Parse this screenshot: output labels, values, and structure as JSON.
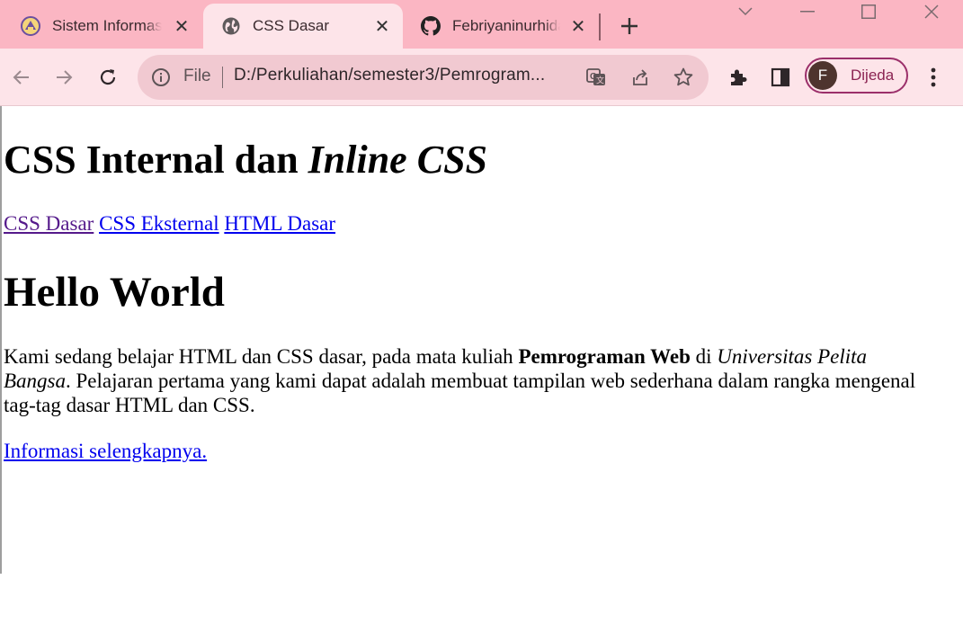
{
  "browser": {
    "tabs": [
      {
        "title": "Sistem Informasi",
        "favicon": "university-crest-icon",
        "active": false
      },
      {
        "title": "CSS Dasar",
        "favicon": "globe-icon",
        "active": true
      },
      {
        "title": "Febriyaninurhidayah",
        "favicon": "github-icon",
        "active": false
      }
    ],
    "new_tab_icon": "plus-icon",
    "omnibox": {
      "scheme_label": "File",
      "url": "D:/Perkuliahan/semester3/Pemrogram..."
    },
    "profile": {
      "initial": "F",
      "name": "Dijeda",
      "avatar_color": "#4e342e",
      "accent": "#9b2f6a"
    },
    "colors": {
      "tabstrip": "#fbb6c3",
      "toolbar": "#fde4e9",
      "omnibox": "#f1c9d1"
    }
  },
  "page": {
    "heading": {
      "plain": "CSS Internal dan ",
      "italic": "Inline CSS"
    },
    "nav_links": [
      "CSS Dasar",
      "CSS Eksternal",
      "HTML Dasar"
    ],
    "subheading": "Hello World",
    "paragraph": {
      "t1": "Kami sedang belajar HTML dan CSS dasar, pada mata kuliah ",
      "bold": "Pemrograman Web",
      "t2": " di ",
      "italic": "Universitas Pelita Bangsa",
      "t3": ". Pelajaran pertama yang kami dapat adalah membuat tampilan web sederhana dalam rangka mengenal tag-tag dasar HTML dan CSS."
    },
    "more_link": "Informasi selengkapnya."
  }
}
